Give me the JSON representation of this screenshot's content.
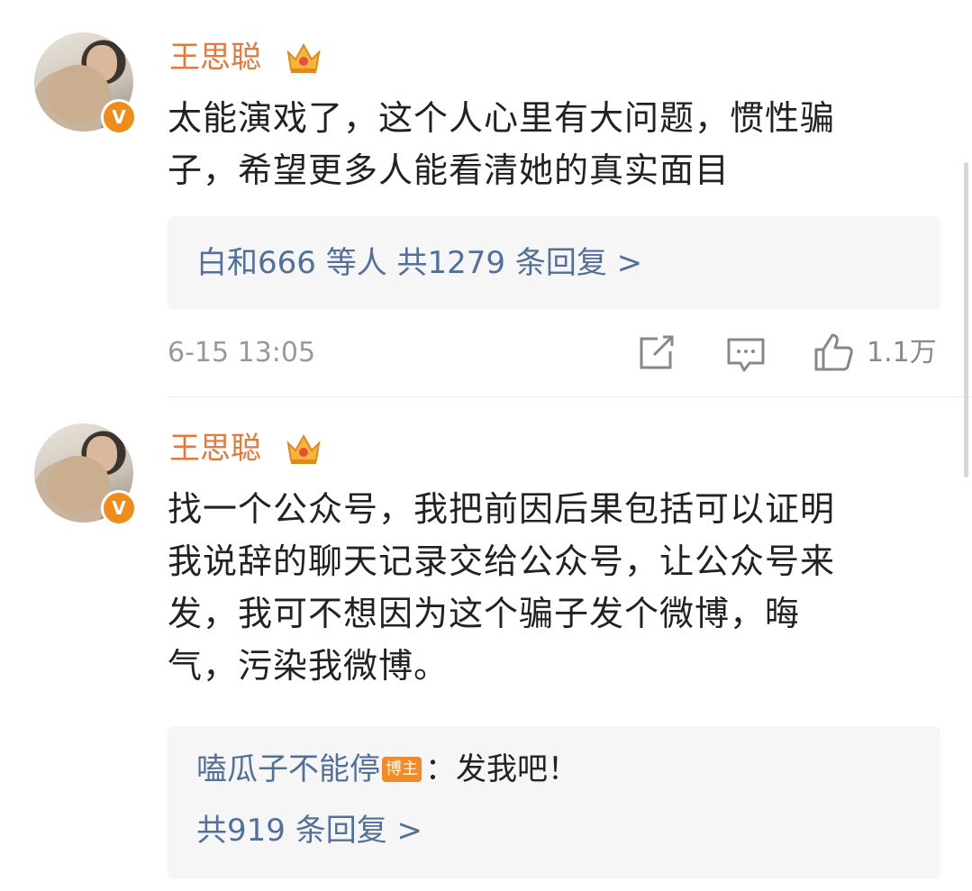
{
  "comments": [
    {
      "username": "王思聪",
      "verified_mark": "V",
      "text_lines": [
        "太能演戏了，这个人心里有大问题，惯性骗",
        "子，希望更多人能看清她的真实面目"
      ],
      "replies_summary": "白和666 等人  共1279 条回复 >",
      "timestamp": "6-15 13:05",
      "likes": "1.1万"
    },
    {
      "username": "王思聪",
      "verified_mark": "V",
      "text_lines": [
        "找一个公众号，我把前因后果包括可以证明",
        "我说辞的聊天记录交给公众号，让公众号来",
        "发，我可不想因为这个骗子发个微博，晦",
        "气，污染我微博。"
      ],
      "top_reply": {
        "author": "嗑瓜子不能停",
        "badge": "博主",
        "text": "：发我吧！"
      },
      "replies_total": "共919 条回复 >"
    }
  ],
  "colors": {
    "username": "#e8773a",
    "link": "#52709a",
    "meta": "#999999",
    "reply_bg": "#f6f6f6",
    "verified": "#f08c1a"
  },
  "icons": [
    "crown-icon",
    "verified-badge-icon",
    "share-icon",
    "comment-icon",
    "like-icon"
  ]
}
